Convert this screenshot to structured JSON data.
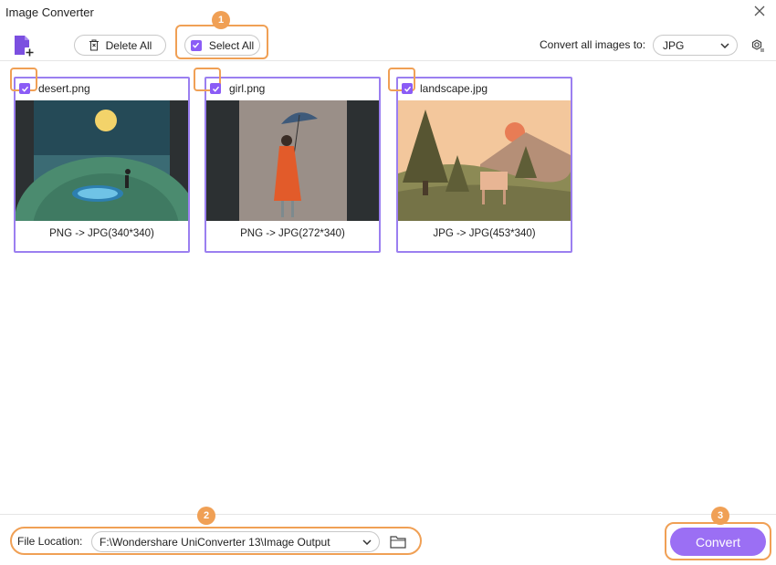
{
  "window": {
    "title": "Image Converter"
  },
  "toolbar": {
    "delete_all_label": "Delete All",
    "select_all_label": "Select All",
    "convert_all_label": "Convert all images to:",
    "format_value": "JPG"
  },
  "badges": {
    "one": "1",
    "two": "2",
    "three": "3"
  },
  "images": [
    {
      "filename": "desert.png",
      "caption": "PNG -> JPG(340*340)",
      "checked": true
    },
    {
      "filename": "girl.png",
      "caption": "PNG -> JPG(272*340)",
      "checked": true
    },
    {
      "filename": "landscape.jpg",
      "caption": "JPG -> JPG(453*340)",
      "checked": true
    }
  ],
  "footer": {
    "file_location_label": "File Location:",
    "file_location_value": "F:\\Wondershare UniConverter 13\\Image Output",
    "convert_label": "Convert"
  },
  "colors": {
    "accent": "#9b6ff4",
    "highlight": "#f0a055",
    "card_border": "#9b7ff0"
  }
}
